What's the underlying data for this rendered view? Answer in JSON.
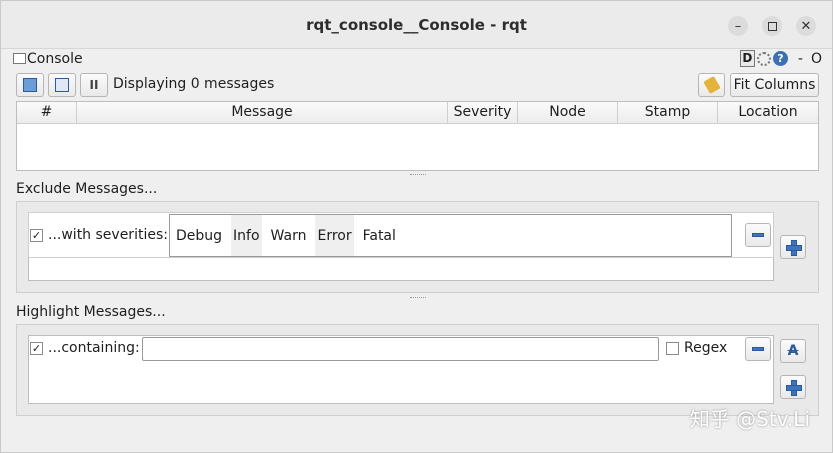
{
  "window": {
    "title": "rqt_console__Console - rqt"
  },
  "plugin": {
    "title": "Console",
    "help_label": "D",
    "minimize_label": "-",
    "close_label": "O"
  },
  "toolbar": {
    "message_count": "Displaying 0 messages",
    "fit_columns_label": "Fit Columns",
    "pause_label": "II"
  },
  "table": {
    "columns": [
      "#",
      "Message",
      "Severity",
      "Node",
      "Stamp",
      "Location"
    ]
  },
  "exclude": {
    "title": "Exclude Messages...",
    "row_label": "...with severities:",
    "checked": true,
    "severities": [
      "Debug",
      "Info",
      "Warn",
      "Error",
      "Fatal"
    ]
  },
  "highlight": {
    "title": "Highlight Messages...",
    "row_label": "...containing:",
    "checked": true,
    "input_value": "",
    "regex_label": "Regex",
    "regex_checked": false
  },
  "watermark": "知乎 @Stv.Li"
}
